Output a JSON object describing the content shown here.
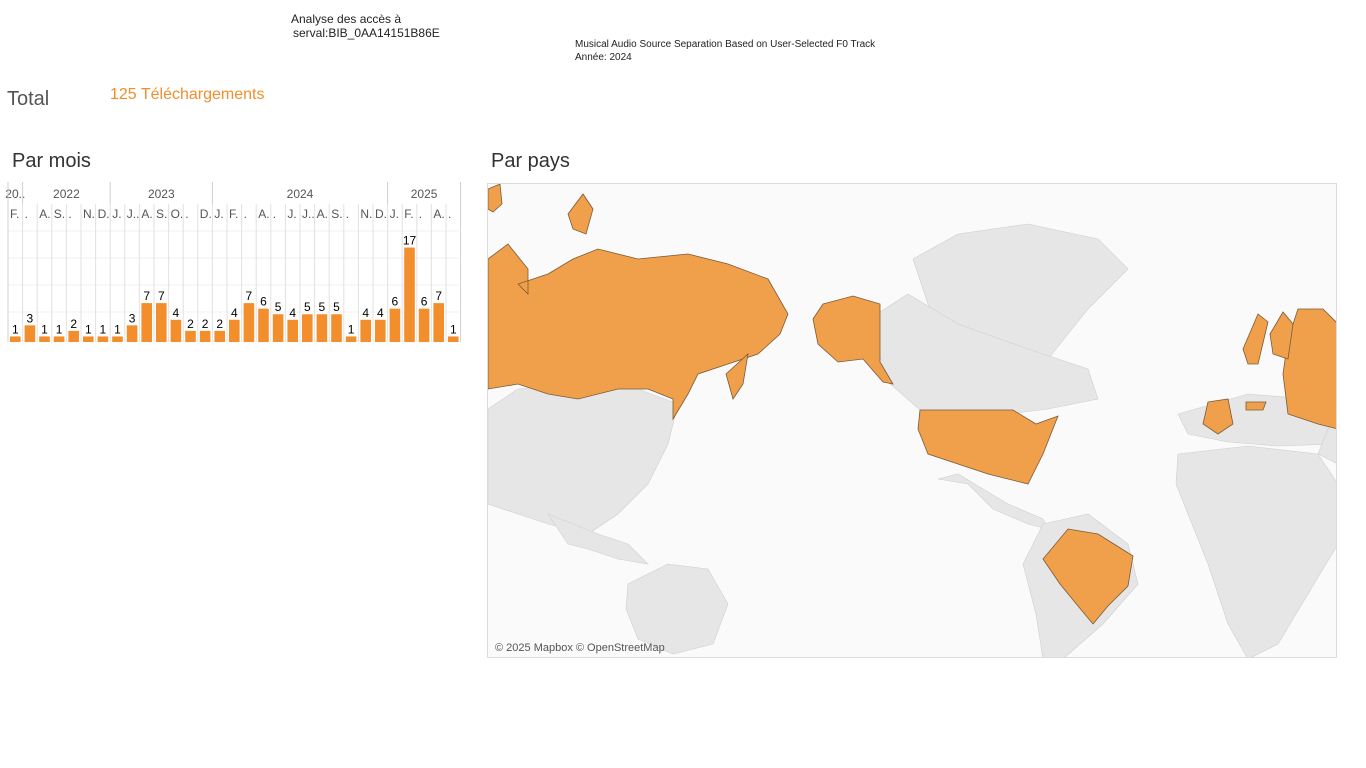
{
  "header": {
    "line1": "Analyse des accès à",
    "line2": "serval:BIB_0AA14151B86E",
    "doc_title": "Musical Audio Source Separation Based on User-Selected F0 Track",
    "year_line": "Année: 2024"
  },
  "summary": {
    "label": "Total",
    "value": "125 Téléchargements"
  },
  "sections": {
    "months_title": "Par mois",
    "country_title": "Par pays"
  },
  "map": {
    "credit": "© 2025 Mapbox © OpenStreetMap",
    "highlight_color": "#f0a04b",
    "base_color": "#e6e6e6",
    "highlighted_countries": [
      "Russia",
      "United States",
      "Brazil",
      "France",
      "Norway",
      "Sweden",
      "Finland",
      "Austria"
    ]
  },
  "colors": {
    "bar": "#f28e2b",
    "total_text": "#f28e2b"
  },
  "chart_data": {
    "type": "bar",
    "years": [
      {
        "label": "20..",
        "span": 1
      },
      {
        "label": "2022",
        "span": 6
      },
      {
        "label": "2023",
        "span": 7
      },
      {
        "label": "2024",
        "span": 12
      },
      {
        "label": "2025",
        "span": 5
      }
    ],
    "month_labels": [
      "F.",
      ".",
      "A.",
      "S.",
      ".",
      "N.",
      "D.",
      "J.",
      "J..",
      "A.",
      "S.",
      "O.",
      ".",
      "D.",
      "J.",
      "F.",
      ".",
      "A.",
      ".",
      "J.",
      "J..",
      "A.",
      "S.",
      ".",
      "N.",
      "D.",
      "J.",
      "F.",
      ".",
      "A.",
      "."
    ],
    "values": [
      1,
      3,
      1,
      1,
      2,
      1,
      1,
      1,
      3,
      7,
      7,
      4,
      2,
      2,
      2,
      4,
      7,
      6,
      5,
      4,
      5,
      5,
      5,
      1,
      4,
      4,
      6,
      17,
      6,
      7,
      1
    ],
    "ylim": [
      0,
      18
    ],
    "xlabel": "",
    "ylabel": ""
  }
}
